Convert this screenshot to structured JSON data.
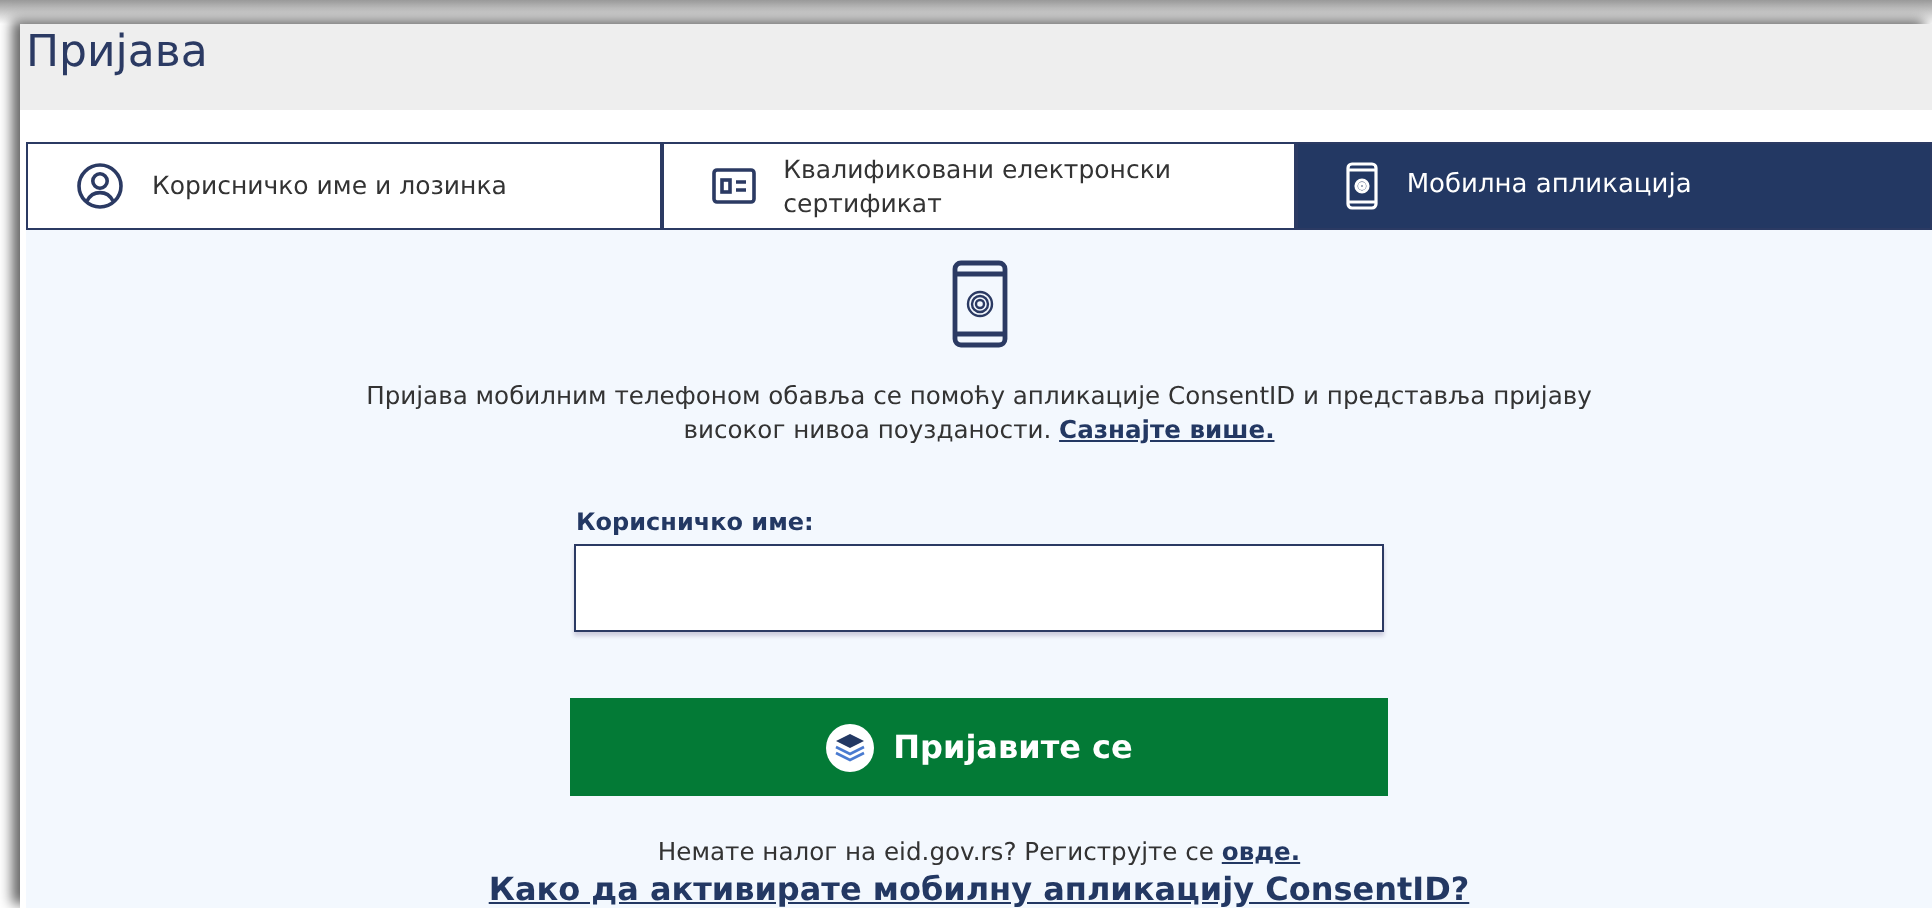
{
  "title": "Пријава",
  "tabs": [
    {
      "label": "Корисничко име и лозинка",
      "kind": "user",
      "selected": false
    },
    {
      "label": "Квалификовани електронски сертификат",
      "kind": "card",
      "selected": false
    },
    {
      "label": "Мобилна апликација",
      "kind": "phone",
      "selected": true
    }
  ],
  "intro": {
    "text": "Пријава мобилним телефоном обавља се помоћу апликације ConsentID и представља пријаву високог нивоа поузданости.",
    "link": "Сазнајте више."
  },
  "username": {
    "label": "Корисничко име:"
  },
  "login_button": "Пријавите се",
  "register": {
    "text": "Немате налог на eid.gov.rs? Региструјте се",
    "link": "овде."
  },
  "help_link": "Како да активирате мобилну апликацију ConsentID?"
}
